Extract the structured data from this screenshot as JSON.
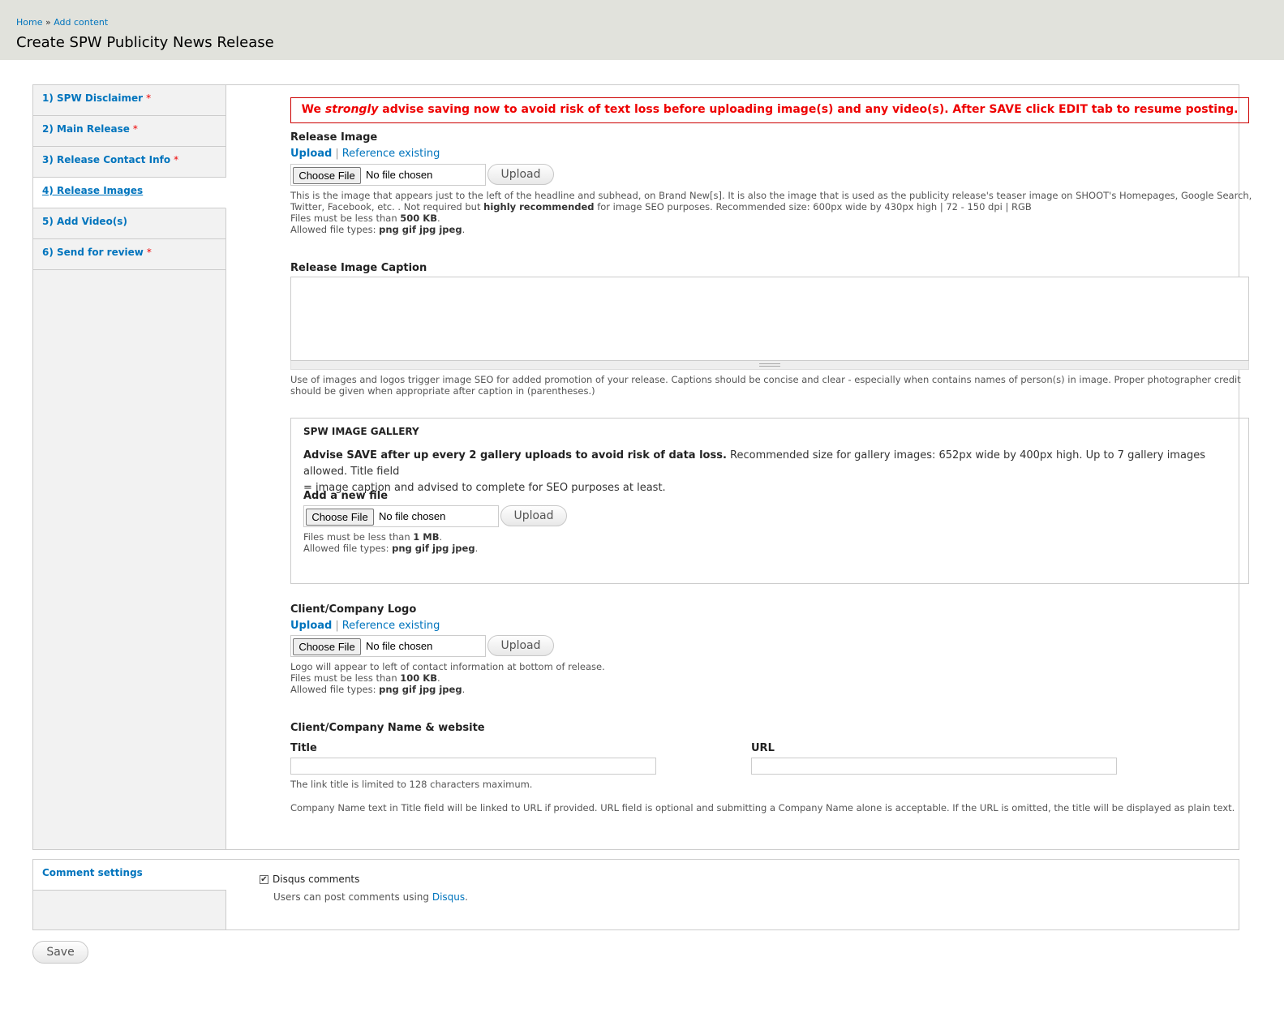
{
  "breadcrumb": {
    "home": "Home",
    "separator": "»",
    "current": "Add content"
  },
  "page_title": "Create SPW Publicity News Release",
  "tabs": [
    {
      "label": "1) SPW Disclaimer",
      "required": "*"
    },
    {
      "label": "2) Main Release",
      "required": "*"
    },
    {
      "label": "3) Release Contact Info",
      "required": "*"
    },
    {
      "label": "4) Release Images",
      "required": ""
    },
    {
      "label": "5) Add Video(s)",
      "required": ""
    },
    {
      "label": "6) Send for review",
      "required": "*"
    }
  ],
  "warning": {
    "pre": "We",
    "emphasis": "strongly",
    "post": "advise saving now to avoid risk of text loss before uploading image(s) and any video(s). After SAVE click EDIT tab to resume posting."
  },
  "release_image": {
    "label": "Release Image",
    "link_upload": "Upload",
    "link_separator": "|",
    "link_reference": "Reference existing",
    "choose_file": "Choose File",
    "no_file": "No file chosen",
    "upload_button": "Upload",
    "desc_line1": "This is the image that appears just to the left of the headline and subhead, on Brand New[s]. It is also the image that is used as the publicity release's teaser image on SHOOT's Homepages, Google Search,",
    "desc_line2_a": "Twitter, Facebook, etc. . Not required but",
    "desc_line2_b": "highly recommended",
    "desc_line2_c": "for image SEO purposes. Recommended size: 600px wide by 430px high | 72 - 150 dpi | RGB",
    "size_prefix": "Files must be less than",
    "size_value": "500 KB",
    "types_prefix": "Allowed file types:",
    "types_value": "png gif jpg jpeg"
  },
  "caption": {
    "label": "Release Image Caption",
    "value": "",
    "desc_line1": "Use of images and logos trigger image SEO for added promotion of your release. Captions should be concise and clear - especially when contains names of person(s) in image. Proper photographer credit",
    "desc_line2": "should be given when appropriate after caption in (parentheses.)"
  },
  "gallery": {
    "legend": "SPW IMAGE GALLERY",
    "advice_bold": "Advise SAVE after up every 2 gallery uploads to avoid risk of data loss.",
    "advice_rest": "Recommended size for gallery images: 652px wide by 400px high. Up to 7 gallery images allowed. Title field",
    "advice_line2": "= image caption and advised to complete for SEO purposes at least.",
    "add_label": "Add a new file",
    "choose_file": "Choose File",
    "no_file": "No file chosen",
    "upload_button": "Upload",
    "size_prefix": "Files must be less than",
    "size_value": "1 MB",
    "types_prefix": "Allowed file types:",
    "types_value": "png gif jpg jpeg"
  },
  "logo": {
    "label": "Client/Company Logo",
    "link_upload": "Upload",
    "link_separator": "|",
    "link_reference": "Reference existing",
    "choose_file": "Choose File",
    "no_file": "No file chosen",
    "upload_button": "Upload",
    "desc": "Logo will appear to left of contact information at bottom of release.",
    "size_prefix": "Files must be less than",
    "size_value": "100 KB",
    "types_prefix": "Allowed file types:",
    "types_value": "png gif jpg jpeg"
  },
  "company": {
    "label": "Client/Company Name & website",
    "title_label": "Title",
    "title_value": "",
    "url_label": "URL",
    "url_value": "",
    "title_desc": "The link title is limited to 128 characters maximum.",
    "desc": "Company Name text in Title field will be linked to URL if provided. URL field is optional and submitting a Company Name alone is acceptable. If the URL is omitted, the title will be displayed as plain text."
  },
  "comments": {
    "tab_label": "Comment settings",
    "checkbox_label": "Disqus comments",
    "checked": true,
    "desc_prefix": "Users can post comments using",
    "desc_link": "Disqus",
    "desc_suffix": "."
  },
  "save_button": "Save",
  "colors": {
    "link": "#0074bd",
    "warning": "#e00000",
    "header_bg": "#e1e2dc"
  }
}
